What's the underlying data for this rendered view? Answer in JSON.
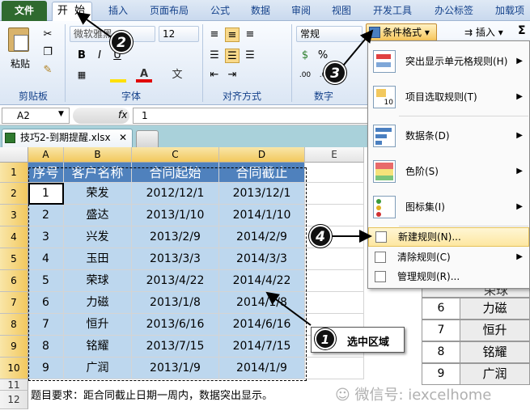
{
  "ribbon_tabs": [
    "文件",
    "开 始",
    "插入",
    "页面布局",
    "公式",
    "数据",
    "审阅",
    "视图",
    "开发工具",
    "办公标签",
    "加载项"
  ],
  "ribbon": {
    "paste_label": "粘贴",
    "font_name": "微软雅黑",
    "font_size": "12",
    "number_format": "常规",
    "cond_format_label": "条件格式",
    "insert_label": "插入",
    "sigma": "Σ",
    "groups": [
      "剪贴板",
      "字体",
      "对齐方式",
      "数字"
    ]
  },
  "formula_bar": {
    "name_box": "A2",
    "fx": "fx",
    "value": "1"
  },
  "workbook_tab": {
    "name": "技巧2-到期提醒.xlsx",
    "close": "✕"
  },
  "columns": [
    "A",
    "B",
    "C",
    "D",
    "E"
  ],
  "rows": [
    "1",
    "2",
    "3",
    "4",
    "5",
    "6",
    "7",
    "8",
    "9",
    "10",
    "11",
    "12"
  ],
  "table": {
    "headers": [
      "序号",
      "客户名称",
      "合同起始",
      "合同截止"
    ],
    "data": [
      [
        "1",
        "荣发",
        "2012/12/1",
        "2013/12/1"
      ],
      [
        "2",
        "盛达",
        "2013/1/10",
        "2014/1/10"
      ],
      [
        "3",
        "兴发",
        "2013/2/9",
        "2014/2/9"
      ],
      [
        "4",
        "玉田",
        "2013/3/3",
        "2014/3/3"
      ],
      [
        "5",
        "荣球",
        "2013/4/22",
        "2014/4/22"
      ],
      [
        "6",
        "力磁",
        "2013/1/8",
        "2014/1/8"
      ],
      [
        "7",
        "恒升",
        "2013/6/16",
        "2014/6/16"
      ],
      [
        "8",
        "铭耀",
        "2013/7/15",
        "2014/7/15"
      ],
      [
        "9",
        "广润",
        "2013/1/9",
        "2014/1/9"
      ]
    ]
  },
  "note": "题目要求：距合同截止日期一周内，数据突出显示。",
  "menu": [
    {
      "label": "突出显示单元格规则(H)",
      "arrow": "▶"
    },
    {
      "label": "项目选取规则(T)",
      "arrow": "▶"
    },
    {
      "label": "数据条(D)",
      "arrow": "▶"
    },
    {
      "label": "色阶(S)",
      "arrow": "▶"
    },
    {
      "label": "图标集(I)",
      "arrow": "▶"
    },
    {
      "label": "新建规则(N)...",
      "arrow": ""
    },
    {
      "label": "清除规则(C)",
      "arrow": "▶"
    },
    {
      "label": "管理规则(R)...",
      "arrow": ""
    }
  ],
  "icon_set_glyph": "10",
  "right_table": [
    {
      "num": "6",
      "name": "力磁"
    },
    {
      "num": "7",
      "name": "恒升"
    },
    {
      "num": "8",
      "name": "铭耀"
    },
    {
      "num": "9",
      "name": "广润"
    }
  ],
  "right_partial": "荣球",
  "callouts": {
    "c1": "1",
    "c1_label": "选中区域",
    "c2": "2",
    "c3": "3",
    "c4": "4"
  },
  "watermark": "微信号: iexcelhome"
}
